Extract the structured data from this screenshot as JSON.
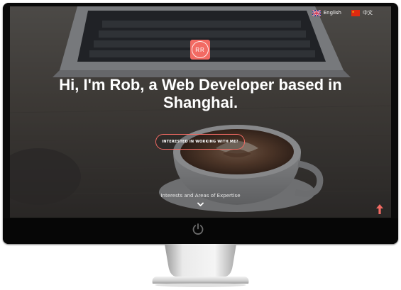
{
  "language_switch": {
    "items": [
      {
        "label": "English",
        "flag": "uk-flag-icon"
      },
      {
        "label": "中文",
        "flag": "china-flag-icon"
      }
    ]
  },
  "logo": {
    "text": "RR",
    "color": "#f26a63"
  },
  "hero": {
    "headline_line1": "Hi, I'm Rob, a Web Developer based in",
    "headline_line2": "Shanghai.",
    "cta_label": "INTERESTED IN WORKING WITH ME?"
  },
  "interests": {
    "label": "Interests and Areas of Expertise",
    "icon": "chevron-down-icon"
  },
  "scroll_top": {
    "icon": "arrow-up-icon",
    "color": "#f26a63"
  },
  "colors": {
    "accent": "#f26a63",
    "bezel": "#0a0a0a",
    "text": "#ffffff"
  }
}
